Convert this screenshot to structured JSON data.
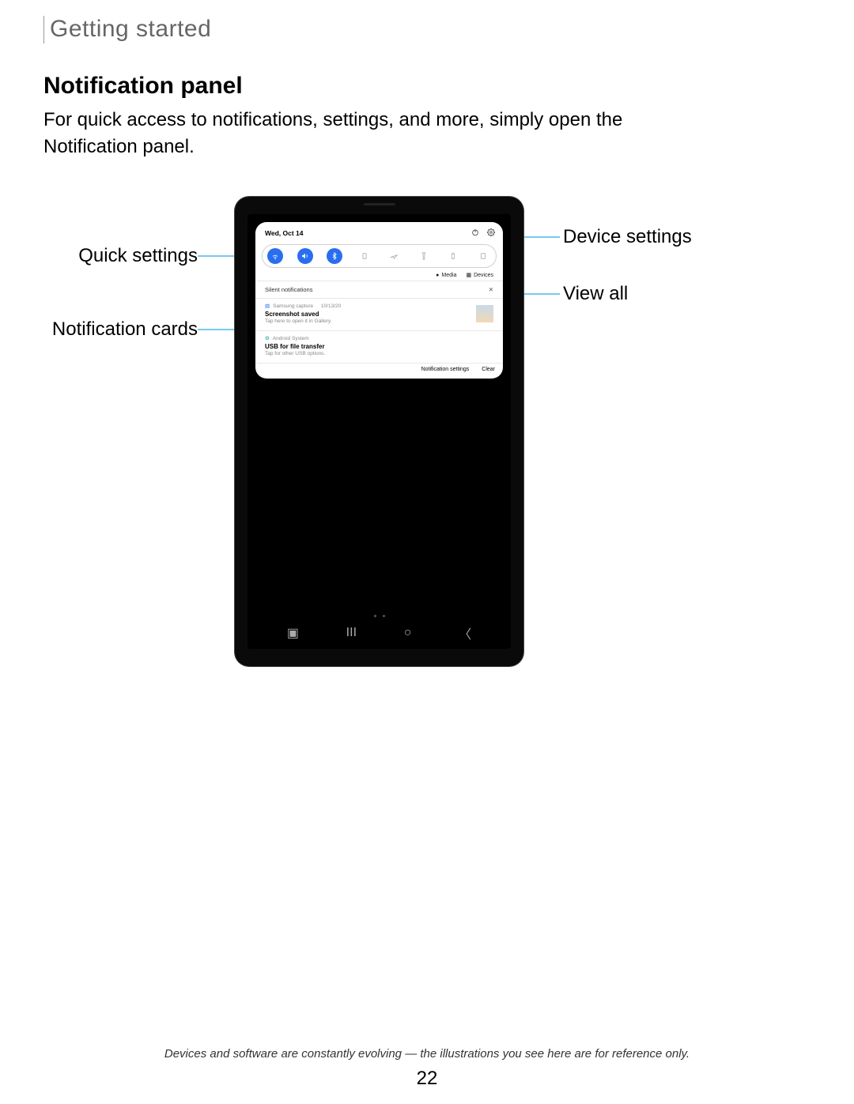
{
  "chapter": "Getting started",
  "section_title": "Notification panel",
  "body": "For quick access to notifications, settings, and more, simply open the Notification panel.",
  "callouts": {
    "quick_settings": "Quick settings",
    "notification_cards": "Notification cards",
    "device_settings": "Device settings",
    "view_all": "View all"
  },
  "panel": {
    "date": "Wed, Oct 14",
    "sub_media": "Media",
    "sub_devices": "Devices",
    "silent_heading": "Silent notifications",
    "notif1_app": "Samsung capture",
    "notif1_time": "10/13/20",
    "notif1_title": "Screenshot saved",
    "notif1_sub": "Tap here to open it in Gallery.",
    "notif2_app": "Android System",
    "notif2_title": "USB for file transfer",
    "notif2_sub": "Tap for other USB options.",
    "footer_settings": "Notification settings",
    "footer_clear": "Clear"
  },
  "footnote": "Devices and software are constantly evolving — the illustrations you see here are for reference only.",
  "page_number": "22"
}
